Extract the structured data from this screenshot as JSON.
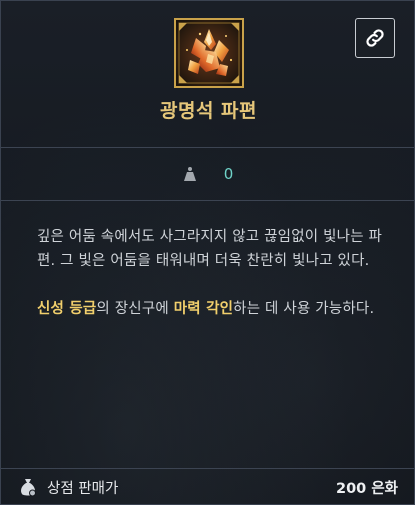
{
  "item": {
    "icon": "radiant-crystal-shard-icon",
    "name": "광명석 파편"
  },
  "toolbar": {
    "link_icon": "link-icon"
  },
  "stats": {
    "weight_icon": "weight-icon",
    "weight_value": "0"
  },
  "description": {
    "p1": "깊은 어둠 속에서도 사그라지지 않고 끊임없이 빛나는 파편. 그 빛은 어둠을 태워내며 더욱 찬란히 빛나고 있다.",
    "p2_parts": {
      "hl1": "신성 등급",
      "t1": "의 장신구에 ",
      "hl2": "마력 각인",
      "t2": "하는 데 사용 가능하다."
    }
  },
  "footer": {
    "vendor_icon": "money-bag-icon",
    "vendor_label": "상점 판매가",
    "price": "200 은화"
  },
  "colors": {
    "name": "#e6c77a",
    "highlight": "#f1cf6c",
    "stat": "#6fd3c8",
    "icon_border": "#c9a24a"
  }
}
